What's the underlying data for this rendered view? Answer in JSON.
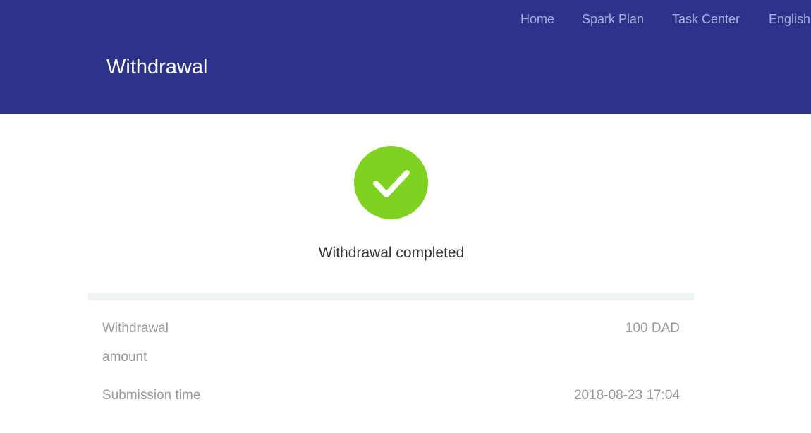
{
  "nav": {
    "home": "Home",
    "spark_plan": "Spark Plan",
    "task_center": "Task Center",
    "language": "English"
  },
  "header": {
    "title": "Withdrawal"
  },
  "status": {
    "icon": "checkmark-icon",
    "text": "Withdrawal completed",
    "color": "#7ed321"
  },
  "details": {
    "amount_label": "Withdrawal amount",
    "amount_value": "100 DAD",
    "time_label": "Submission time",
    "time_value": "2018-08-23 17:04"
  },
  "colors": {
    "header_bg": "#2d328a",
    "divider": "#eef4f4"
  }
}
